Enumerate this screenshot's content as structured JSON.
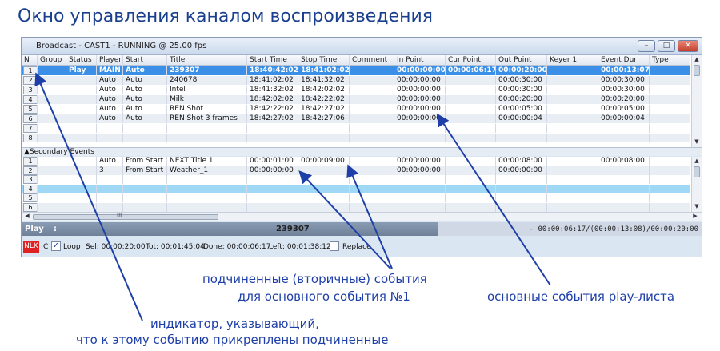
{
  "heading": "Окно управления каналом воспроизведения",
  "window": {
    "title": "Broadcast - CAST1 - RUNNING @ 25.00 fps",
    "min_glyph": "–",
    "max_glyph": "□",
    "close_glyph": "✕"
  },
  "main_table": {
    "headers": [
      "N",
      "Group",
      "Status",
      "Player",
      "Start",
      "Title",
      "Start Time",
      "Stop Time",
      "Comment",
      "In Point",
      "Cur Point",
      "Out Point",
      "Keyer 1",
      "Event Dur",
      "Type"
    ],
    "rows": [
      {
        "n": "1",
        "group": "",
        "status": "Play",
        "player": "MAIN",
        "start": "Auto",
        "title": "239307",
        "start_time": "18:40:42:02",
        "stop_time": "18:41:02:02",
        "comment": "",
        "in_point": "00:00:00:00",
        "cur_point": "00:00:06:17",
        "out_point": "00:00:20:00",
        "keyer": "",
        "event_dur": "00:00:13:07",
        "type": ""
      },
      {
        "n": "2",
        "group": "",
        "status": "",
        "player": "Auto",
        "start": "Auto",
        "title": "240678",
        "start_time": "18:41:02:02",
        "stop_time": "18:41:32:02",
        "comment": "",
        "in_point": "00:00:00:00",
        "cur_point": "",
        "out_point": "00:00:30:00",
        "keyer": "",
        "event_dur": "00:00:30:00",
        "type": ""
      },
      {
        "n": "3",
        "group": "",
        "status": "",
        "player": "Auto",
        "start": "Auto",
        "title": "Intel",
        "start_time": "18:41:32:02",
        "stop_time": "18:42:02:02",
        "comment": "",
        "in_point": "00:00:00:00",
        "cur_point": "",
        "out_point": "00:00:30:00",
        "keyer": "",
        "event_dur": "00:00:30:00",
        "type": ""
      },
      {
        "n": "4",
        "group": "",
        "status": "",
        "player": "Auto",
        "start": "Auto",
        "title": "Milk",
        "start_time": "18:42:02:02",
        "stop_time": "18:42:22:02",
        "comment": "",
        "in_point": "00:00:00:00",
        "cur_point": "",
        "out_point": "00:00:20:00",
        "keyer": "",
        "event_dur": "00:00:20:00",
        "type": ""
      },
      {
        "n": "5",
        "group": "",
        "status": "",
        "player": "Auto",
        "start": "Auto",
        "title": "REN Shot",
        "start_time": "18:42:22:02",
        "stop_time": "18:42:27:02",
        "comment": "",
        "in_point": "00:00:00:00",
        "cur_point": "",
        "out_point": "00:00:05:00",
        "keyer": "",
        "event_dur": "00:00:05:00",
        "type": ""
      },
      {
        "n": "6",
        "group": "",
        "status": "",
        "player": "Auto",
        "start": "Auto",
        "title": "REN Shot 3 frames",
        "start_time": "18:42:27:02",
        "stop_time": "18:42:27:06",
        "comment": "",
        "in_point": "00:00:00:00",
        "cur_point": "",
        "out_point": "00:00:00:04",
        "keyer": "",
        "event_dur": "00:00:00:04",
        "type": ""
      },
      {
        "n": "7",
        "group": "",
        "status": "",
        "player": "",
        "start": "",
        "title": "",
        "start_time": "",
        "stop_time": "",
        "comment": "",
        "in_point": "",
        "cur_point": "",
        "out_point": "",
        "keyer": "",
        "event_dur": "",
        "type": ""
      },
      {
        "n": "8",
        "group": "",
        "status": "",
        "player": "",
        "start": "",
        "title": "",
        "start_time": "",
        "stop_time": "",
        "comment": "",
        "in_point": "",
        "cur_point": "",
        "out_point": "",
        "keyer": "",
        "event_dur": "",
        "type": ""
      }
    ]
  },
  "secondary": {
    "label": "▲Secondary Events",
    "rows": [
      {
        "n": "1",
        "player": "Auto",
        "start": "From Start",
        "title": "NEXT Title 1",
        "start_time": "00:00:01:00",
        "stop_time": "00:00:09:00",
        "in_point": "00:00:00:00",
        "out_point": "00:00:08:00",
        "event_dur": "00:00:08:00"
      },
      {
        "n": "2",
        "player": "3",
        "start": "From Start",
        "title": "Weather_1",
        "start_time": "00:00:00:00",
        "stop_time": "",
        "in_point": "00:00:00:00",
        "out_point": "00:00:00:00",
        "event_dur": ""
      },
      {
        "n": "3",
        "player": "",
        "start": "",
        "title": "",
        "start_time": "",
        "stop_time": "",
        "in_point": "",
        "out_point": "",
        "event_dur": ""
      },
      {
        "n": "4",
        "player": "",
        "start": "",
        "title": "",
        "start_time": "",
        "stop_time": "",
        "in_point": "",
        "out_point": "",
        "event_dur": ""
      },
      {
        "n": "5",
        "player": "",
        "start": "",
        "title": "",
        "start_time": "",
        "stop_time": "",
        "in_point": "",
        "out_point": "",
        "event_dur": ""
      },
      {
        "n": "6",
        "player": "",
        "start": "",
        "title": "",
        "start_time": "",
        "stop_time": "",
        "in_point": "",
        "out_point": "",
        "event_dur": ""
      }
    ]
  },
  "hscroll_grip": "III",
  "status_bar": {
    "state": "Play",
    "colon": ":",
    "clip": "239307",
    "timecode": "- 00:00:06:17/(00:00:13:08)/00:00:20:00"
  },
  "bottom_bar": {
    "nlk": "NLK",
    "c": "C",
    "loop_label": "Loop",
    "loop_checked": true,
    "sel": "Sel: 00:00:20:00",
    "tot": "Tot: 00:01:45:04",
    "done": "Done: 00:00:06:17",
    "left": "Left: 00:01:38:12",
    "replace_label": "Replace",
    "replace_checked": false
  },
  "annotations": {
    "secondary_line1": "подчиненные (вторичные) события",
    "secondary_line2": "для основного события №1",
    "main_events": "основные события play-листа",
    "indicator_line1": "индикатор, указывающий,",
    "indicator_line2": "что к этому событию прикреплены подчиненные"
  },
  "colors": {
    "selected_row": "#3b8fe6",
    "cyan_row": "#9ed8f5",
    "annotation": "#1e3fa8",
    "nlk": "#e02222"
  }
}
